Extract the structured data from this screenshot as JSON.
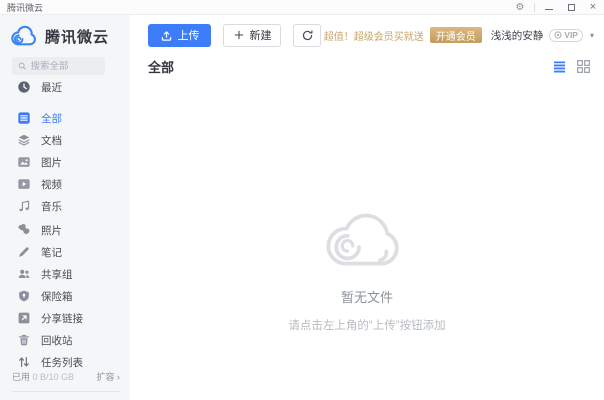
{
  "window": {
    "title": "腾讯微云"
  },
  "sidebar": {
    "logo_text": "腾讯微云",
    "search_placeholder": "搜索全部",
    "groups": [
      {
        "items": [
          {
            "label": "最近"
          }
        ]
      },
      {
        "items": [
          {
            "label": "全部"
          },
          {
            "label": "文档"
          },
          {
            "label": "图片"
          },
          {
            "label": "视频"
          },
          {
            "label": "音乐"
          }
        ]
      },
      {
        "items": [
          {
            "label": "照片"
          },
          {
            "label": "笔记"
          },
          {
            "label": "共享组"
          },
          {
            "label": "保险箱"
          },
          {
            "label": "分享链接"
          },
          {
            "label": "回收站"
          },
          {
            "label": "任务列表"
          }
        ]
      }
    ],
    "storage": {
      "used_label": "已用",
      "usage": "0 B/10 GB",
      "expand_label": "扩容 ›"
    }
  },
  "toolbar": {
    "upload_label": "上传",
    "new_label": "新建",
    "promo_text": "超值！超级会员买就送",
    "open_vip_label": "开通会员",
    "username": "浅浅的安静",
    "vip_badge_label": "VIP"
  },
  "content": {
    "header_title": "全部",
    "empty_title": "暂无文件",
    "empty_subtitle": "请点击左上角的“上传”按钮添加"
  },
  "colors": {
    "accent_blue": "#3d7ef8",
    "promo_gold": "#c7a469",
    "sidebar_bg": "#f5f6f8",
    "icon_gray": "#8a919b",
    "empty_gray": "#dcdee1"
  }
}
